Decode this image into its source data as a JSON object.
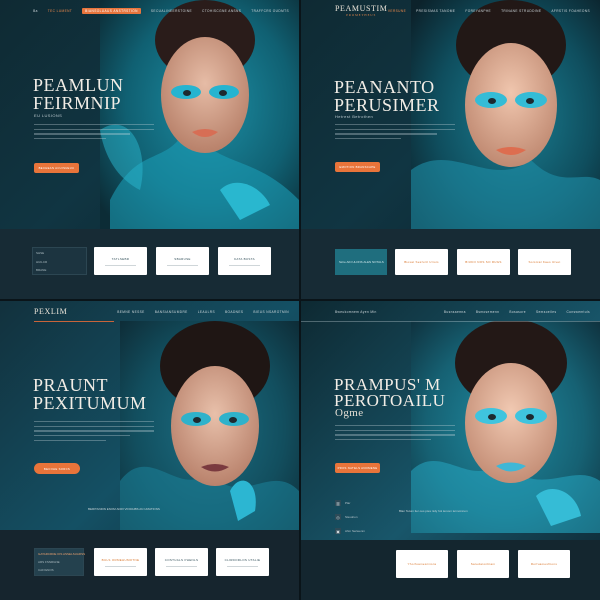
{
  "panels": [
    {
      "nav": [
        "Ba",
        "TEC LUMENT",
        "BIANSOLUAUS ANSTRSTION",
        "SECUALINEERSTOINE",
        "CTOHISCGNE ANSNS",
        "TRAFFCRS OUDMTS"
      ],
      "title_lines": [
        "PEAMLUN",
        "FEIRMNIP"
      ],
      "subtitle": "EU LUSIONS",
      "cta": "BECHEAN ACUISUEUU",
      "band_labels": [
        "SHSE",
        "HUILCR",
        "BRANE"
      ],
      "cards": [
        "TATLSEBR",
        "SBARUSE",
        "KATA BUSTA"
      ]
    },
    {
      "brand": "PEAMUSTIM",
      "brand_sub": "PROMETHEUS",
      "nav": [
        "VERSUNE",
        "PRESISMAS TANOME",
        "FOREYANPHE",
        "TRINANE STRUDDINE",
        "AFRSTIS FOAHEONS"
      ],
      "title_lines": [
        "PEANANTO",
        "PERUSIMER"
      ],
      "subtitle": "Hetrest Betrothen",
      "cta": "EMOTION BRANSCAPE",
      "teal": "Sicre AIN ULONS ALEN NOTALS",
      "cards": [
        "Biosat Sesfurtl Uriom",
        "BIUKO NOS SO RUGS",
        "Sorstcal Kaes Utvet"
      ]
    },
    {
      "brand": "PEXLIM",
      "nav": [
        "BEMNE NESSE",
        "BANSIANSUMDRE",
        "LEAULRS",
        "BOADNES",
        "BIEUS NSAROTMIN"
      ],
      "title_lines": [
        "PRAUNT",
        "PEXITUMUM"
      ],
      "cta": "BECOHE SORCS",
      "caption": "BERITANDIN ENOM ADRI VIORAIBS AN UMATIONS",
      "dark_box": [
        "GATARCRDE IOS ASSELSUARSS",
        "ARS FSNRGNE",
        "CAFIGNOS"
      ],
      "cards": [
        "BULS ORMEHUMOTNE",
        "COSTUALS PHENLS",
        "CLIRDORLOS UTALIE"
      ]
    },
    {
      "nav_left": "Bweukomnem Ayen Min",
      "nav": [
        "Busnsaemra",
        "Bsmosemenn",
        "Bosasore",
        "Semsoeiles",
        "Cunswemtuls"
      ],
      "title_lines": [
        "PRAMPUS' M",
        "PEROTOAILU"
      ],
      "subtitle": "Ogme",
      "cta": "PROS NATELS ANOMENE",
      "side": [
        "Plar",
        "Sisuohon",
        "Ahm Serteenm"
      ],
      "caption": "Blan Tetum lier ous ptes nidy hol lemom lermoinnon",
      "cards": [
        "Yhorfuamesntions",
        "Saredaronbtam",
        "Rorfuamesftions"
      ]
    }
  ],
  "colors": {
    "accent": "#e8743a",
    "teal": "#2cb6d2",
    "navy": "#0f2a33"
  }
}
